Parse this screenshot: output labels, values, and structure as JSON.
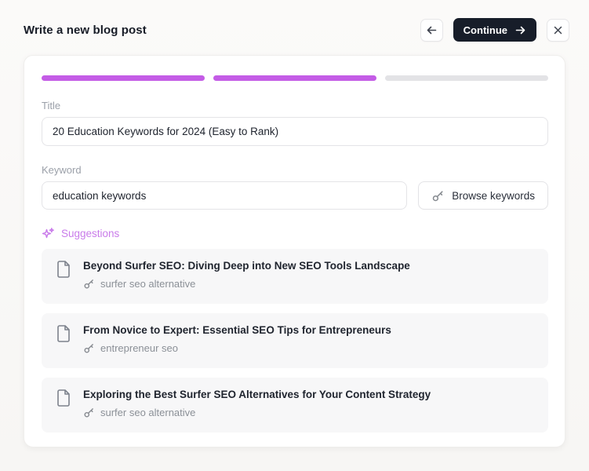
{
  "header": {
    "title": "Write a new blog post",
    "continue_label": "Continue"
  },
  "progress": {
    "segments": [
      "filled",
      "filled",
      "empty"
    ]
  },
  "form": {
    "title_label": "Title",
    "title_value": "20 Education Keywords for 2024 (Easy to Rank)",
    "keyword_label": "Keyword",
    "keyword_value": "education keywords",
    "browse_button_label": "Browse keywords"
  },
  "suggestions": {
    "heading": "Suggestions",
    "items": [
      {
        "title": "Beyond Surfer SEO: Diving Deep into New SEO Tools Landscape",
        "keyword": "surfer seo alternative"
      },
      {
        "title": "From Novice to Expert: Essential SEO Tips for Entrepreneurs",
        "keyword": "entrepreneur seo"
      },
      {
        "title": "Exploring the Best Surfer SEO Alternatives for Your Content Strategy",
        "keyword": "surfer seo alternative"
      }
    ]
  },
  "colors": {
    "accent_purple": "#c45ce6",
    "progress_empty": "#e3e3e6",
    "continue_button_bg": "#171d29",
    "suggestions_text": "#c97bea",
    "suggestion_card_bg": "#f7f7f8"
  }
}
